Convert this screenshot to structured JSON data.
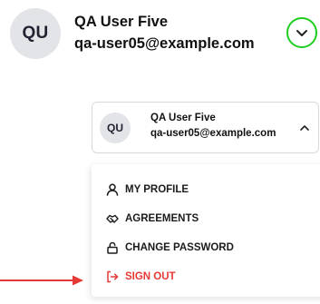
{
  "header": {
    "avatar_initials": "QU",
    "name": "QA User Five",
    "email": "qa-user05@example.com",
    "toggle_icon": "chevron-down-icon",
    "highlight_color": "#1fcf1f"
  },
  "user_button": {
    "avatar_initials": "QU",
    "name": "QA User Five",
    "email": "qa-user05@example.com",
    "toggle_icon": "chevron-up-icon"
  },
  "menu": {
    "items": [
      {
        "label": "MY PROFILE",
        "icon": "user-icon"
      },
      {
        "label": "AGREEMENTS",
        "icon": "handshake-icon"
      },
      {
        "label": "CHANGE PASSWORD",
        "icon": "lock-icon"
      },
      {
        "label": "SIGN OUT",
        "icon": "sign-out-icon",
        "color": "#e53935"
      }
    ]
  },
  "annotation": {
    "arrow_color": "#e53935"
  }
}
